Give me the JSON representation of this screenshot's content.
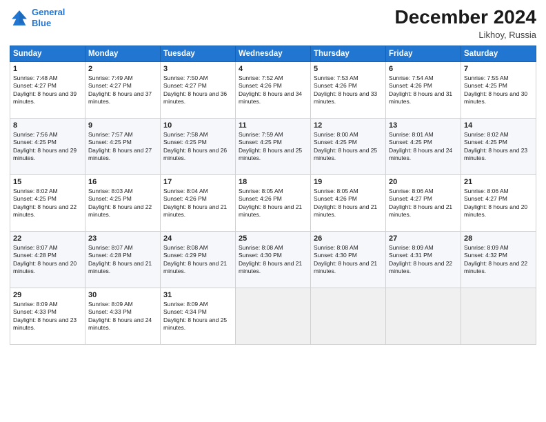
{
  "header": {
    "logo_line1": "General",
    "logo_line2": "Blue",
    "month": "December 2024",
    "location": "Likhoy, Russia"
  },
  "weekdays": [
    "Sunday",
    "Monday",
    "Tuesday",
    "Wednesday",
    "Thursday",
    "Friday",
    "Saturday"
  ],
  "weeks": [
    [
      {
        "day": "1",
        "rise": "7:48 AM",
        "set": "4:27 PM",
        "daylight": "8 hours and 39 minutes."
      },
      {
        "day": "2",
        "rise": "7:49 AM",
        "set": "4:27 PM",
        "daylight": "8 hours and 37 minutes."
      },
      {
        "day": "3",
        "rise": "7:50 AM",
        "set": "4:27 PM",
        "daylight": "8 hours and 36 minutes."
      },
      {
        "day": "4",
        "rise": "7:52 AM",
        "set": "4:26 PM",
        "daylight": "8 hours and 34 minutes."
      },
      {
        "day": "5",
        "rise": "7:53 AM",
        "set": "4:26 PM",
        "daylight": "8 hours and 33 minutes."
      },
      {
        "day": "6",
        "rise": "7:54 AM",
        "set": "4:26 PM",
        "daylight": "8 hours and 31 minutes."
      },
      {
        "day": "7",
        "rise": "7:55 AM",
        "set": "4:25 PM",
        "daylight": "8 hours and 30 minutes."
      }
    ],
    [
      {
        "day": "8",
        "rise": "7:56 AM",
        "set": "4:25 PM",
        "daylight": "8 hours and 29 minutes."
      },
      {
        "day": "9",
        "rise": "7:57 AM",
        "set": "4:25 PM",
        "daylight": "8 hours and 27 minutes."
      },
      {
        "day": "10",
        "rise": "7:58 AM",
        "set": "4:25 PM",
        "daylight": "8 hours and 26 minutes."
      },
      {
        "day": "11",
        "rise": "7:59 AM",
        "set": "4:25 PM",
        "daylight": "8 hours and 25 minutes."
      },
      {
        "day": "12",
        "rise": "8:00 AM",
        "set": "4:25 PM",
        "daylight": "8 hours and 25 minutes."
      },
      {
        "day": "13",
        "rise": "8:01 AM",
        "set": "4:25 PM",
        "daylight": "8 hours and 24 minutes."
      },
      {
        "day": "14",
        "rise": "8:02 AM",
        "set": "4:25 PM",
        "daylight": "8 hours and 23 minutes."
      }
    ],
    [
      {
        "day": "15",
        "rise": "8:02 AM",
        "set": "4:25 PM",
        "daylight": "8 hours and 22 minutes."
      },
      {
        "day": "16",
        "rise": "8:03 AM",
        "set": "4:25 PM",
        "daylight": "8 hours and 22 minutes."
      },
      {
        "day": "17",
        "rise": "8:04 AM",
        "set": "4:26 PM",
        "daylight": "8 hours and 21 minutes."
      },
      {
        "day": "18",
        "rise": "8:05 AM",
        "set": "4:26 PM",
        "daylight": "8 hours and 21 minutes."
      },
      {
        "day": "19",
        "rise": "8:05 AM",
        "set": "4:26 PM",
        "daylight": "8 hours and 21 minutes."
      },
      {
        "day": "20",
        "rise": "8:06 AM",
        "set": "4:27 PM",
        "daylight": "8 hours and 21 minutes."
      },
      {
        "day": "21",
        "rise": "8:06 AM",
        "set": "4:27 PM",
        "daylight": "8 hours and 20 minutes."
      }
    ],
    [
      {
        "day": "22",
        "rise": "8:07 AM",
        "set": "4:28 PM",
        "daylight": "8 hours and 20 minutes."
      },
      {
        "day": "23",
        "rise": "8:07 AM",
        "set": "4:28 PM",
        "daylight": "8 hours and 21 minutes."
      },
      {
        "day": "24",
        "rise": "8:08 AM",
        "set": "4:29 PM",
        "daylight": "8 hours and 21 minutes."
      },
      {
        "day": "25",
        "rise": "8:08 AM",
        "set": "4:30 PM",
        "daylight": "8 hours and 21 minutes."
      },
      {
        "day": "26",
        "rise": "8:08 AM",
        "set": "4:30 PM",
        "daylight": "8 hours and 21 minutes."
      },
      {
        "day": "27",
        "rise": "8:09 AM",
        "set": "4:31 PM",
        "daylight": "8 hours and 22 minutes."
      },
      {
        "day": "28",
        "rise": "8:09 AM",
        "set": "4:32 PM",
        "daylight": "8 hours and 22 minutes."
      }
    ],
    [
      {
        "day": "29",
        "rise": "8:09 AM",
        "set": "4:33 PM",
        "daylight": "8 hours and 23 minutes."
      },
      {
        "day": "30",
        "rise": "8:09 AM",
        "set": "4:33 PM",
        "daylight": "8 hours and 24 minutes."
      },
      {
        "day": "31",
        "rise": "8:09 AM",
        "set": "4:34 PM",
        "daylight": "8 hours and 25 minutes."
      },
      null,
      null,
      null,
      null
    ]
  ]
}
